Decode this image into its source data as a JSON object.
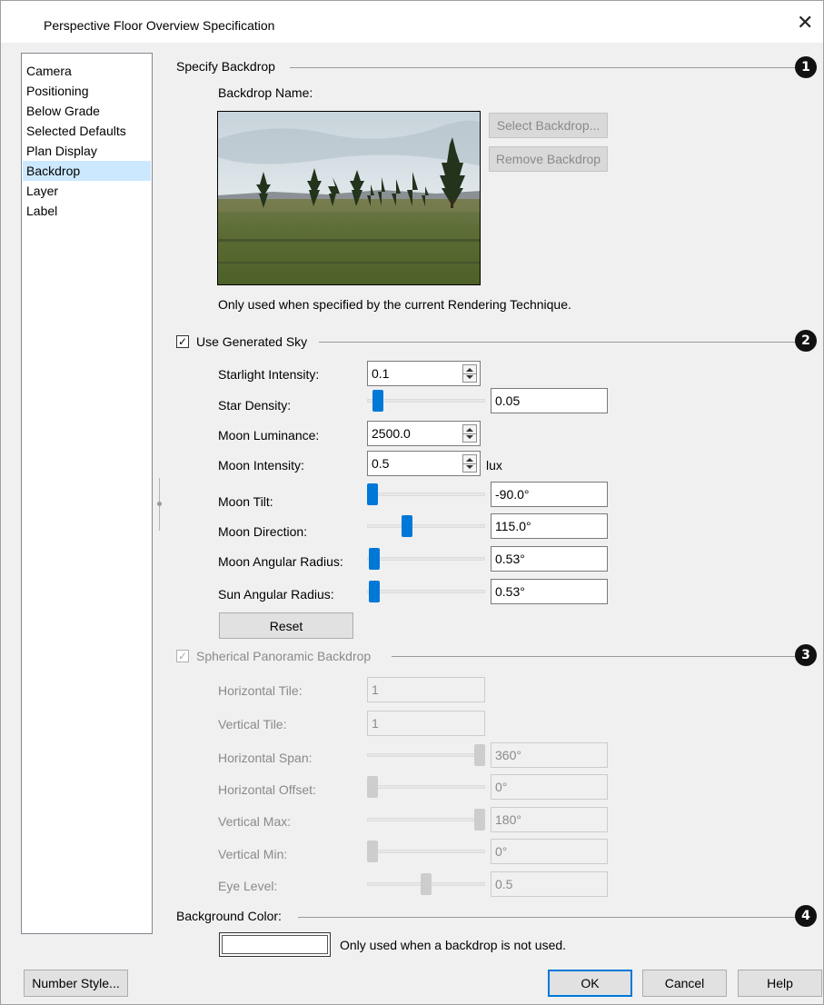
{
  "window": {
    "title": "Perspective Floor Overview Specification",
    "close_glyph": "✕"
  },
  "sidebar": {
    "items": [
      {
        "label": "Camera",
        "active": false
      },
      {
        "label": "Positioning",
        "active": false
      },
      {
        "label": "Below Grade",
        "active": false
      },
      {
        "label": "Selected Defaults",
        "active": false
      },
      {
        "label": "Plan Display",
        "active": false
      },
      {
        "label": "Backdrop",
        "active": true
      },
      {
        "label": "Layer",
        "active": false
      },
      {
        "label": "Label",
        "active": false
      }
    ]
  },
  "backdrop": {
    "section_title": "Specify Backdrop",
    "callout": "1",
    "name_label": "Backdrop Name:",
    "image": "landscape-meadow-photo",
    "select_button": "Select Backdrop...",
    "remove_button": "Remove Backdrop",
    "note": "Only used when specified by the current Rendering Technique."
  },
  "sky": {
    "section_title": "Use Generated Sky",
    "checked": true,
    "callout": "2",
    "starlight_intensity": {
      "label": "Starlight Intensity:",
      "value": "0.1"
    },
    "star_density": {
      "label": "Star Density:",
      "value": "0.05",
      "slider": 0.05
    },
    "moon_luminance": {
      "label": "Moon Luminance:",
      "value": "2500.0"
    },
    "moon_intensity": {
      "label": "Moon Intensity:",
      "value": "0.5",
      "unit": "lux"
    },
    "moon_tilt": {
      "label": "Moon Tilt:",
      "value": "-90.0°",
      "slider": 0.0
    },
    "moon_direction": {
      "label": "Moon Direction:",
      "value": "115.0°",
      "slider": 0.32
    },
    "moon_angular_radius": {
      "label": "Moon Angular Radius:",
      "value": "0.53°",
      "slider": 0.02
    },
    "sun_angular_radius": {
      "label": "Sun Angular Radius:",
      "value": "0.53°",
      "slider": 0.02
    },
    "reset_button": "Reset"
  },
  "panoramic": {
    "section_title": "Spherical Panoramic Backdrop",
    "checked": true,
    "enabled": false,
    "callout": "3",
    "horizontal_tile": {
      "label": "Horizontal Tile:",
      "value": "1"
    },
    "vertical_tile": {
      "label": "Vertical Tile:",
      "value": "1"
    },
    "horizontal_span": {
      "label": "Horizontal Span:",
      "value": "360°",
      "slider": 1.0
    },
    "horizontal_offset": {
      "label": "Horizontal Offset:",
      "value": "0°",
      "slider": 0.0
    },
    "vertical_max": {
      "label": "Vertical Max:",
      "value": "180°",
      "slider": 1.0
    },
    "vertical_min": {
      "label": "Vertical Min:",
      "value": "0°",
      "slider": 0.0
    },
    "eye_level": {
      "label": "Eye Level:",
      "value": "0.5",
      "slider": 0.5
    }
  },
  "background": {
    "section_title": "Background Color:",
    "callout": "4",
    "color": "#ffffff",
    "note": "Only used when a backdrop is not used."
  },
  "footer": {
    "number_style_button": "Number Style...",
    "ok_button": "OK",
    "cancel_button": "Cancel",
    "help_button": "Help"
  }
}
